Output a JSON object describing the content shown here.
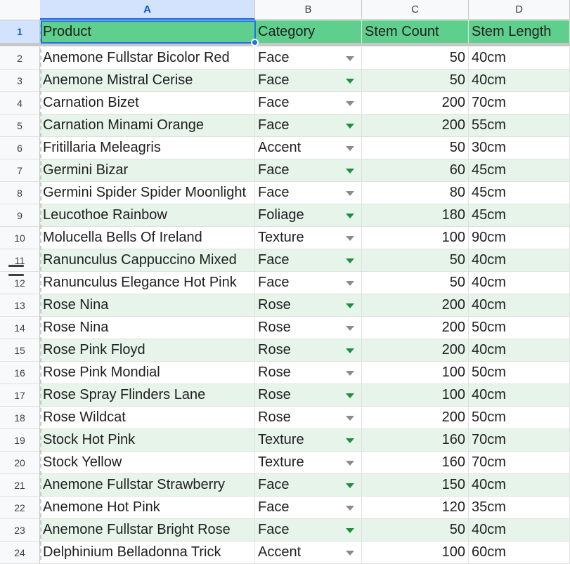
{
  "columns": [
    "A",
    "B",
    "C",
    "D"
  ],
  "selected_column": "A",
  "header_row": {
    "row_number": "1",
    "product": "Product",
    "category": "Category",
    "stem_count": "Stem Count",
    "stem_length": "Stem Length"
  },
  "rows": [
    {
      "num": "2",
      "product": "Anemone Fullstar Bicolor Red",
      "category": "Face",
      "count": "50",
      "length": "40cm"
    },
    {
      "num": "3",
      "product": "Anemone Mistral Cerise",
      "category": "Face",
      "count": "50",
      "length": "40cm"
    },
    {
      "num": "4",
      "product": "Carnation Bizet",
      "category": "Face",
      "count": "200",
      "length": "70cm"
    },
    {
      "num": "5",
      "product": "Carnation Minami Orange",
      "category": "Face",
      "count": "200",
      "length": "55cm"
    },
    {
      "num": "6",
      "product": "Fritillaria Meleagris",
      "category": "Accent",
      "count": "50",
      "length": "30cm"
    },
    {
      "num": "7",
      "product": "Germini Bizar",
      "category": "Face",
      "count": "60",
      "length": "45cm"
    },
    {
      "num": "8",
      "product": "Germini Spider Spider Moonlight",
      "category": "Face",
      "count": "80",
      "length": "45cm"
    },
    {
      "num": "9",
      "product": "Leucothoe Rainbow",
      "category": "Foliage",
      "count": "180",
      "length": "45cm"
    },
    {
      "num": "10",
      "product": "Molucella Bells Of Ireland",
      "category": "Texture",
      "count": "100",
      "length": "90cm"
    },
    {
      "num": "11",
      "product": "Ranunculus Cappuccino Mixed",
      "category": "Face",
      "count": "50",
      "length": "40cm"
    },
    {
      "num": "12",
      "product": "Ranunculus Elegance Hot Pink",
      "category": "Face",
      "count": "50",
      "length": "40cm"
    },
    {
      "num": "13",
      "product": "Rose Nina",
      "category": "Rose",
      "count": "200",
      "length": "40cm"
    },
    {
      "num": "14",
      "product": "Rose Nina",
      "category": "Rose",
      "count": "200",
      "length": "50cm"
    },
    {
      "num": "15",
      "product": "Rose Pink Floyd",
      "category": "Rose",
      "count": "200",
      "length": "40cm"
    },
    {
      "num": "16",
      "product": "Rose Pink Mondial",
      "category": "Rose",
      "count": "100",
      "length": "50cm"
    },
    {
      "num": "17",
      "product": "Rose Spray Flinders Lane",
      "category": "Rose",
      "count": "100",
      "length": "40cm"
    },
    {
      "num": "18",
      "product": "Rose Wildcat",
      "category": "Rose",
      "count": "200",
      "length": "50cm"
    },
    {
      "num": "19",
      "product": "Stock Hot Pink",
      "category": "Texture",
      "count": "160",
      "length": "70cm"
    },
    {
      "num": "20",
      "product": "Stock Yellow",
      "category": "Texture",
      "count": "160",
      "length": "70cm"
    },
    {
      "num": "21",
      "product": "Anemone Fullstar Strawberry",
      "category": "Face",
      "count": "150",
      "length": "40cm"
    },
    {
      "num": "22",
      "product": "Anemone Hot Pink",
      "category": "Face",
      "count": "120",
      "length": "35cm"
    },
    {
      "num": "23",
      "product": "Anemone Fullstar Bright Rose",
      "category": "Face",
      "count": "50",
      "length": "40cm"
    },
    {
      "num": "24",
      "product": "Delphinium Belladonna Trick",
      "category": "Accent",
      "count": "100",
      "length": "60cm"
    }
  ],
  "colors": {
    "header_fill": "#5fcf8e",
    "band_fill": "#e6f4ea",
    "selection": "#1a73e8",
    "dropdown_green": "#1e8e3e",
    "dropdown_gray": "#8a8a8a"
  }
}
